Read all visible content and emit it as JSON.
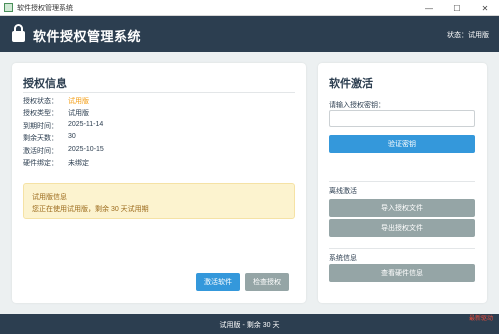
{
  "window": {
    "title": "软件授权管理系统",
    "controls": {
      "minimize": "—",
      "maximize": "☐",
      "close": "✕"
    }
  },
  "header": {
    "title": "软件授权管理系统",
    "status": "状态：试用版"
  },
  "license_info": {
    "title": "授权信息",
    "rows": [
      {
        "label": "授权状态：",
        "value": "试用版"
      },
      {
        "label": "授权类型：",
        "value": "试用版"
      },
      {
        "label": "到期时间：",
        "value": "2025-11-14"
      },
      {
        "label": "剩余天数：",
        "value": "30"
      },
      {
        "label": "激活时间：",
        "value": "2025-10-15"
      },
      {
        "label": "硬件绑定：",
        "value": "未绑定"
      }
    ],
    "notice": {
      "title": "试用版信息",
      "text": "您正在使用试用版，剩余 30 天试用期"
    },
    "buttons": {
      "activate": "激活软件",
      "check": "检查授权"
    }
  },
  "activation": {
    "title": "软件激活",
    "input_label": "请输入授权密钥：",
    "input_value": "",
    "verify_button": "验证密钥",
    "offline_label": "离线激活",
    "import_button": "导入授权文件",
    "export_button": "导出授权文件",
    "system_label": "系统信息",
    "hardware_button": "查看硬件信息"
  },
  "statusbar": {
    "text": "试用版 - 剩余 30 天",
    "watermark": "最新驱动"
  },
  "colors": {
    "header": "#2c3e50",
    "accent": "#3498db",
    "gray_button": "#95a5a6",
    "status_orange": "#f39c12",
    "notice_bg": "#fcf3cf"
  }
}
